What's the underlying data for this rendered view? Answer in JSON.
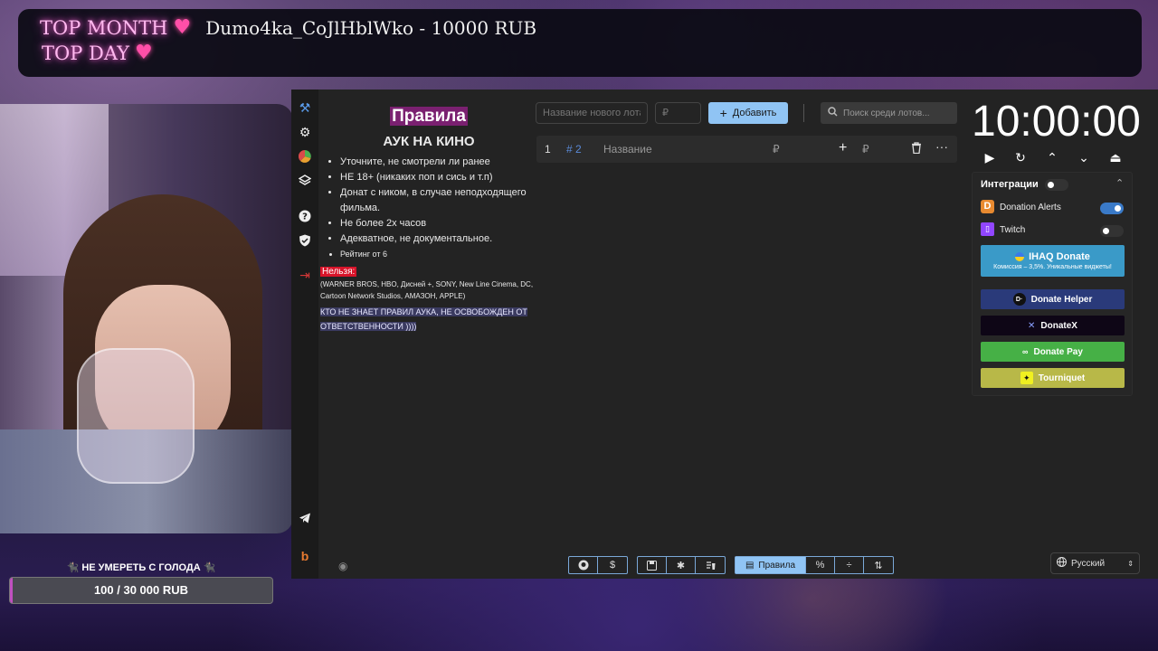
{
  "overlay": {
    "top_month_label": "TOP MONTH",
    "top_day_label": "TOP DAY",
    "top_name": "Dumo4ka_CoJlHblWko - 10000 RUB",
    "goal_title": "🐈‍⬛ НЕ УМЕРЕТЬ С ГОЛОДА 🐈‍⬛",
    "goal_text": "100 / 30 000 RUB",
    "goal_progress": 0.0033
  },
  "rules": {
    "title": "Правила",
    "subtitle": "АУК НА КИНО",
    "items": [
      "Уточните, не смотрели ли ранее",
      "НЕ 18+ (никаких поп и сись и т.п)",
      "Донат с ником, в случае неподходящего фильма.",
      "Не более 2х часов",
      "Адекватное, не документальное.",
      "Рейтинг от 6"
    ],
    "forbidden_label": "Нельзя:",
    "forbidden_list": "(WARNER BROS, HBO, Дисней +, SONY, New Line Cinema, DC, Cartoon Network Studios, АМАЗОН, APPLE)",
    "warning": "КТО НЕ ЗНАЕТ ПРАВИЛ АУКА, НЕ ОСВОБОЖДЕН ОТ ОТВЕТСТВЕННОСТИ ))))"
  },
  "lot_form": {
    "name_placeholder": "Название нового лота",
    "amount_placeholder": "₽",
    "add_label": "Добавить",
    "search_placeholder": "Поиск среди лотов..."
  },
  "lots": [
    {
      "index": "1",
      "id": "# 2",
      "name": "Название",
      "currency": "₽",
      "add_currency": "₽"
    }
  ],
  "timer": {
    "value": "10:00:00"
  },
  "integrations": {
    "title": "Интеграции",
    "items": [
      {
        "name": "Donation Alerts",
        "enabled": true
      },
      {
        "name": "Twitch",
        "enabled": false
      }
    ],
    "services": [
      {
        "name": "IHAQ Donate",
        "note": "Комиссия – 3,5%. Уникальные виджеты!",
        "color": "#3a9ac8"
      },
      {
        "name": "Donate Helper",
        "color": "#2a3a7a"
      },
      {
        "name": "DonateX",
        "color": "#0e0616"
      },
      {
        "name": "Donate Pay",
        "color": "#46b046"
      },
      {
        "name": "Tourniquet",
        "color": "#b8b848"
      }
    ]
  },
  "bottom": {
    "rules_tab_label": "Правила",
    "language": "Русский"
  }
}
